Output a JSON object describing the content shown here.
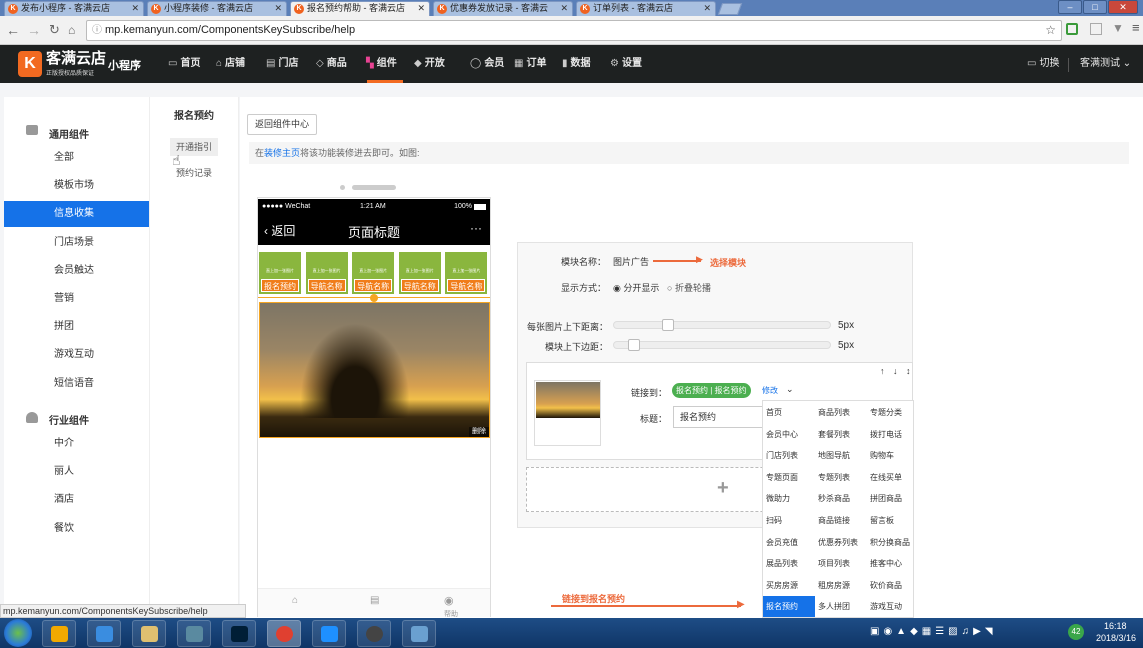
{
  "browser": {
    "tabs": [
      {
        "title": "发布小程序 - 客满云店",
        "active": false
      },
      {
        "title": "小程序装修 - 客满云店",
        "active": false
      },
      {
        "title": "报名预约帮助 - 客满云店",
        "active": true
      },
      {
        "title": "优惠券发放记录 - 客满云",
        "active": false
      },
      {
        "title": "订单列表 - 客满云店",
        "active": false
      }
    ],
    "url": "mp.kemanyun.com/ComponentsKeySubscribe/help",
    "status_url": "mp.kemanyun.com/ComponentsKeySubscribe/help"
  },
  "header": {
    "logo_text": "客满云店",
    "logo_sub": "正版授权品质保证",
    "logo_letter": "K",
    "app_label": "小程序",
    "menu": [
      {
        "label": "首页",
        "icon": "▭"
      },
      {
        "label": "店铺",
        "icon": "⌂"
      },
      {
        "label": "门店",
        "icon": "▤"
      },
      {
        "label": "商品",
        "icon": "◇"
      },
      {
        "label": "组件",
        "icon": "▚",
        "active": true
      },
      {
        "label": "开放",
        "icon": "◆"
      },
      {
        "label": "会员",
        "icon": "◯"
      },
      {
        "label": "订单",
        "icon": "▦"
      },
      {
        "label": "数据",
        "icon": "▮"
      },
      {
        "label": "设置",
        "icon": "⚙"
      }
    ],
    "switch_label": "切换",
    "user_label": "客满测试",
    "accent": "#f26a21"
  },
  "sidebar": {
    "group1": "通用组件",
    "items1": [
      "全部",
      "模板市场",
      "信息收集",
      "门店场景",
      "会员触达",
      "营销",
      "拼团",
      "游戏互动",
      "短信语音"
    ],
    "selected": "信息收集",
    "group2": "行业组件",
    "items2": [
      "中介",
      "丽人",
      "酒店",
      "餐饮"
    ]
  },
  "subnav": {
    "title": "报名预约",
    "items": [
      "开通指引",
      "预约记录"
    ]
  },
  "content": {
    "back_button": "返回组件中心",
    "notice_link": "装修主页",
    "notice_prefix": "在",
    "notice_text": "将该功能装修进去即可。如图:"
  },
  "phone": {
    "carrier": "●●●●● WeChat",
    "time": "1:21 AM",
    "battery": "100%",
    "back": "返回",
    "title": "页面标题",
    "more": "···",
    "nav_cells": [
      {
        "label": "报名预约",
        "top": "直上加一张图片"
      },
      {
        "label": "导航名称",
        "top": "直上加一张图片"
      },
      {
        "label": "导航名称",
        "top": "直上加一张图片"
      },
      {
        "label": "导航名称",
        "top": "直上加一张图片"
      },
      {
        "label": "导航名称",
        "top": "直上加一张图片"
      }
    ],
    "delete": "删除",
    "bottom_label": "帮助"
  },
  "panel": {
    "module_name_label": "模块名称：",
    "module_name_value": "图片广告",
    "select_note": "选择模块",
    "display_label": "显示方式：",
    "display_options": [
      "分开显示",
      "折叠轮播"
    ],
    "spacing_label": "每张图片上下距离：",
    "spacing_value": "5px",
    "margin_label": "模块上下边距：",
    "margin_value": "5px",
    "link_label": "链接到：",
    "link_tag": "报名预约 | 报名预约",
    "link_modify": "修改",
    "title_label": "标题：",
    "title_value": "报名预约",
    "arrows": "↑ ↓ ↕",
    "add": "+",
    "link_note": "链接到报名预约"
  },
  "dropdown": {
    "items": [
      [
        "首页",
        "商品列表",
        "专题分类"
      ],
      [
        "会员中心",
        "套餐列表",
        "拨打电话"
      ],
      [
        "门店列表",
        "地图导航",
        "购物车"
      ],
      [
        "专题页面",
        "专题列表",
        "在线买单"
      ],
      [
        "微助力",
        "秒杀商品",
        "拼团商品"
      ],
      [
        "扫码",
        "商品链接",
        "留言板"
      ],
      [
        "会员充值",
        "优惠券列表",
        "积分换商品"
      ],
      [
        "展品列表",
        "项目列表",
        "推客中心"
      ],
      [
        "买房房源",
        "租房房源",
        "砍价商品"
      ],
      [
        "报名预约",
        "多人拼团",
        "游戏互动"
      ]
    ],
    "selected": "报名预约"
  },
  "taskbar": {
    "time": "16:18",
    "date": "2018/3/16",
    "badge": "42"
  }
}
